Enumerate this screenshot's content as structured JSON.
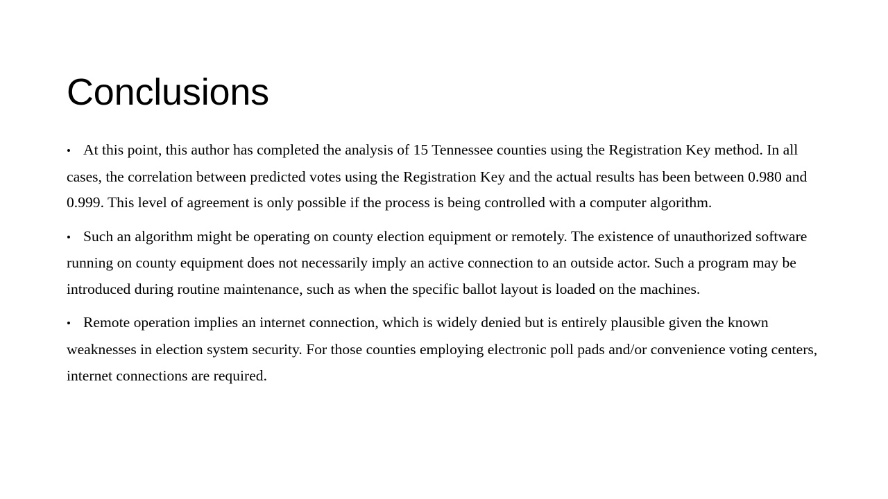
{
  "slide": {
    "title": "Conclusions",
    "background_color": "#ffffff",
    "text_color": "#000000",
    "bullet_glyph": "•",
    "bullets": [
      {
        "marker": "•",
        "text": "At this point, this author has completed the analysis of 15 Tennessee counties using the Registration Key method. In all cases, the correlation between predicted votes using the Registration Key and the actual results has been between 0.980 and 0.999.  This level of agreement is only possible if the process is being controlled with a computer algorithm."
      },
      {
        "marker": "•",
        "text": "Such an algorithm might be operating on county election equipment or remotely.  The existence of unauthorized software running on county equipment does not necessarily imply an active connection to an outside actor.  Such a program may be introduced during routine maintenance, such as when the specific ballot layout is loaded on the machines."
      },
      {
        "marker": "•",
        "text": "Remote operation implies an internet connection, which is widely denied but is entirely plausible given the known weaknesses in election system security.  For those counties employing electronic poll pads and/or convenience voting centers, internet connections are required."
      }
    ]
  }
}
